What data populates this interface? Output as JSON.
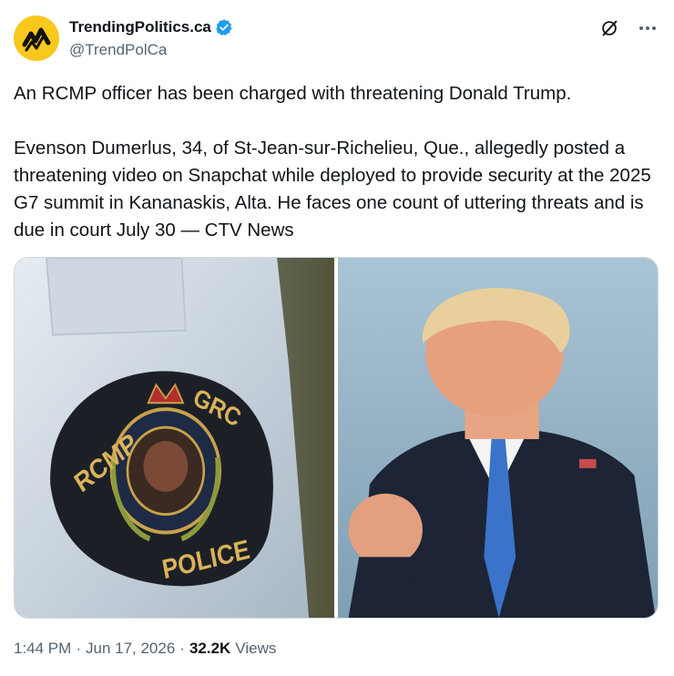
{
  "author": {
    "display_name": "TrendingPolitics.ca",
    "handle": "@TrendPolCa",
    "verified": true,
    "avatar_color": "#f8c81c"
  },
  "header_icons": [
    "grok-icon",
    "more-icon"
  ],
  "tweet": {
    "paragraphs": [
      "An RCMP officer has been charged with threatening Donald Trump.",
      "Evenson Dumerlus, 34, of St-Jean-sur-Richelieu, Que., allegedly posted a threatening video on Snapchat while deployed to provide security at the 2025 G7 summit in Kananaskis, Alta. He faces one count of uttering threats and is due in court July 30 — CTV News"
    ]
  },
  "media": {
    "left": {
      "patch_left_text": "RCMP",
      "patch_right_text": "GRC",
      "patch_bottom_text": "POLICE"
    }
  },
  "meta": {
    "time": "1:44 PM",
    "separator": "·",
    "date": "Jun 17, 2026",
    "views_count": "32.2K",
    "views_label": "Views"
  },
  "colors": {
    "verified": "#1d9bf0",
    "secondary_text": "#536471"
  }
}
